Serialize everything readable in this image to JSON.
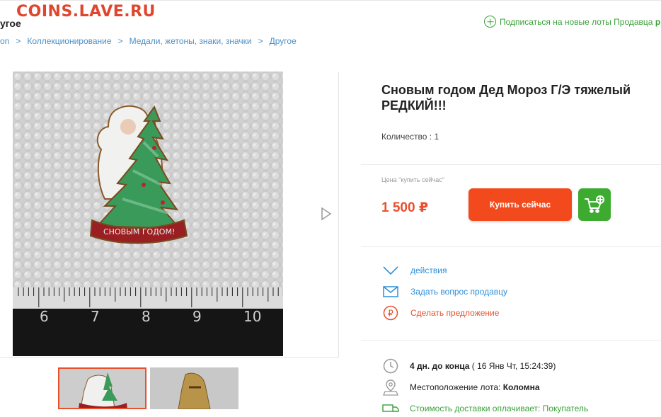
{
  "watermark": "COINS.LAVE.RU",
  "header": {
    "category_title": "угое",
    "subscribe_text": "Подписаться на новые лоты Продавца",
    "subscribe_tail": "р"
  },
  "breadcrumbs": [
    {
      "label": "on"
    },
    {
      "label": "Коллекционирование"
    },
    {
      "label": "Медали, жетоны, знаки, значки"
    },
    {
      "label": "Другое"
    }
  ],
  "breadcrumb_separator": ">",
  "lot": {
    "title_line1": "Сновым годом Дед Мороз Г/Э тяжелый",
    "title_line2": "РЕДКИЙ!!!",
    "quantity": "Количество : 1",
    "price_caption": "Цена \"купить сейчас\"",
    "price": "1 500 ₽",
    "buy_label": "Купить сейчас",
    "badge_text": "СНОВЫМ ГОДОМ!"
  },
  "ruler": {
    "numbers": [
      "6",
      "7",
      "8",
      "9",
      "10"
    ]
  },
  "actions": [
    {
      "label": "действия",
      "icon": "chevron-down-icon",
      "color": "#2f8fd8"
    },
    {
      "label": "Задать вопрос продавцу",
      "icon": "envelope-icon",
      "color": "#2f8fd8"
    },
    {
      "label": "Сделать предложение",
      "icon": "ruble-circle-icon",
      "color": "#e8502e"
    }
  ],
  "info": {
    "time_bold": "4 дн. до конца",
    "time_rest": "( 16 Янв Чт, 15:24:39)",
    "location_label": "Местоположение лота:",
    "location_value": "Коломна",
    "shipping_text": "Стоимость доставки оплачивает: Покупатель"
  },
  "colors": {
    "accent": "#f24a1d",
    "price": "#e8502e",
    "cart": "#3dab2f",
    "link": "#4a90c8",
    "subscribe": "#3aa13a"
  }
}
